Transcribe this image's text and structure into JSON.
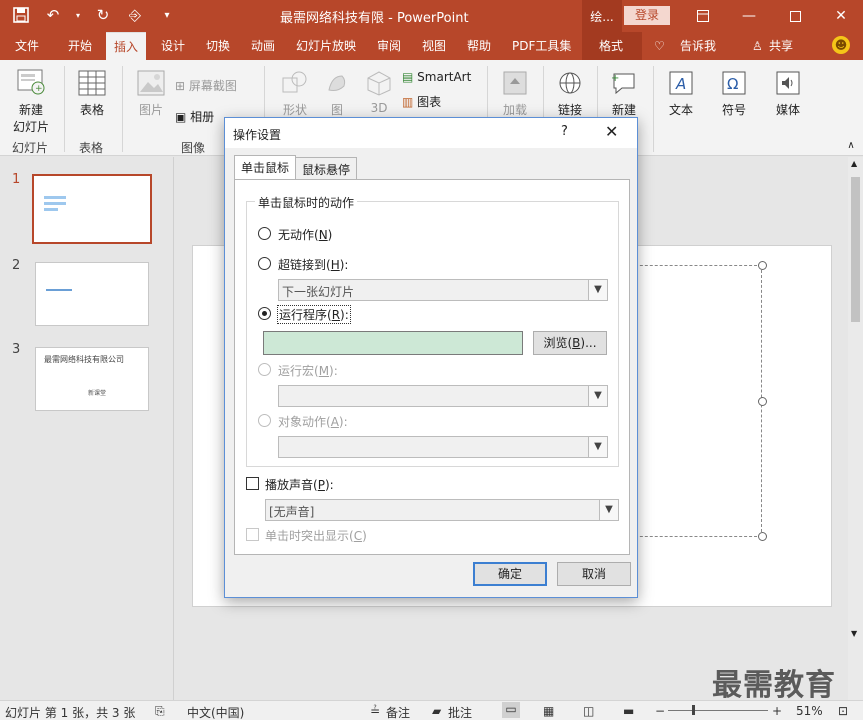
{
  "window": {
    "title": "最需网络科技有限  -  PowerPoint",
    "context_tab": "绘...",
    "login_label": "登录",
    "controls": [
      "ribbon-display",
      "minimize",
      "maximize",
      "close"
    ]
  },
  "menu": {
    "tabs": [
      "文件",
      "开始",
      "插入",
      "设计",
      "切换",
      "动画",
      "幻灯片放映",
      "审阅",
      "视图",
      "帮助",
      "PDF工具集",
      "格式"
    ],
    "active": "插入",
    "tell_me": "告诉我",
    "share": "共享"
  },
  "ribbon": {
    "new_slide": "新建\n幻灯片",
    "new_slide_l1": "新建",
    "new_slide_l2": "幻灯片",
    "group_slides": "幻灯片",
    "table": "表格",
    "group_table": "表格",
    "picture": "图片",
    "screenshot": "屏幕截图",
    "album": "相册",
    "group_images": "图像",
    "shapes": "形状",
    "icons": "图",
    "model3d": "3D",
    "smartart": "SmartArt",
    "chart": "图表",
    "addins": "加载",
    "link": "链接",
    "new_comment": "新建",
    "text": "文本",
    "symbol": "符号",
    "media": "媒体"
  },
  "thumbnails": [
    {
      "num": "1",
      "text": ""
    },
    {
      "num": "2",
      "text": ""
    },
    {
      "num": "3",
      "title": "最需网络科技有限公司",
      "subtitle": "新课堂"
    }
  ],
  "status": {
    "slide_info": "幻灯片 第 1 张，共 3 张",
    "language": "中文(中国)",
    "notes": "备注",
    "comments": "批注",
    "zoom": "51%"
  },
  "watermark": "最需教育",
  "dialog": {
    "title": "操作设置",
    "help": "?",
    "tabs": [
      "单击鼠标",
      "鼠标悬停"
    ],
    "group_label": "单击鼠标时的动作",
    "options": {
      "none": {
        "label": "无动作(",
        "key": "N",
        "suffix": ")"
      },
      "hyperlink": {
        "label": "超链接到(",
        "key": "H",
        "suffix": "):",
        "value": "下一张幻灯片"
      },
      "run_program": {
        "label": "运行程序(",
        "key": "R",
        "suffix": "):",
        "value": ""
      },
      "run_macro": {
        "label": "运行宏(",
        "key": "M",
        "suffix": "):"
      },
      "object_action": {
        "label": "对象动作(",
        "key": "A",
        "suffix": "):"
      }
    },
    "browse": {
      "label": "浏览(",
      "key": "B",
      "suffix": ")..."
    },
    "play_sound": {
      "label": "播放声音(",
      "key": "P",
      "suffix": "):",
      "value": "[无声音]"
    },
    "highlight": {
      "label": "单击时突出显示(",
      "key": "C",
      "suffix": ")"
    },
    "ok": "确定",
    "cancel": "取消"
  }
}
